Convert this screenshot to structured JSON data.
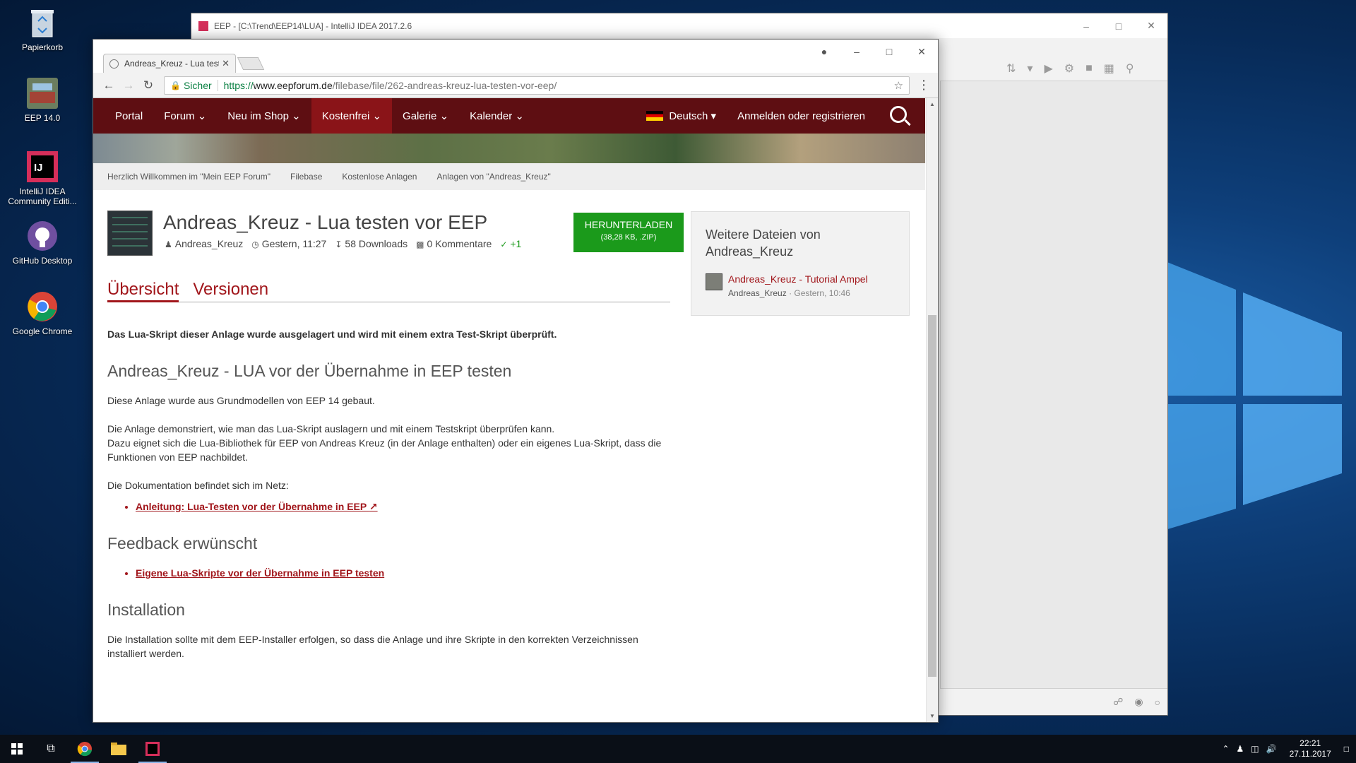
{
  "desktop": {
    "icons": [
      {
        "label": "Papierkorb",
        "icon": "recycle-bin-icon"
      },
      {
        "label": "EEP 14.0",
        "icon": "eep-icon"
      },
      {
        "label": "IntelliJ IDEA Community Editi...",
        "icon": "intellij-icon"
      },
      {
        "label": "GitHub Desktop",
        "icon": "github-icon"
      },
      {
        "label": "Google Chrome",
        "icon": "chrome-icon"
      }
    ]
  },
  "intellij": {
    "title": "EEP - [C:\\Trend\\EEP14\\LUA] - IntelliJ IDEA 2017.2.6"
  },
  "chrome": {
    "tab_title": "Andreas_Kreuz - Lua testen vor EEP",
    "secure_label": "Sicher",
    "url": {
      "scheme": "https://",
      "host": "www.eepforum.de",
      "path": "/filebase/file/262-andreas-kreuz-lua-testen-vor-eep/"
    }
  },
  "site": {
    "nav": [
      "Portal",
      "Forum",
      "Neu im Shop",
      "Kostenfrei",
      "Galerie",
      "Kalender"
    ],
    "nav_caret": [
      "",
      "⌄",
      "⌄",
      "⌄",
      "⌄",
      "⌄"
    ],
    "language": "Deutsch",
    "login": "Anmelden oder registrieren",
    "breadcrumb": [
      "Herzlich Willkommen im \"Mein EEP Forum\"",
      "Filebase",
      "Kostenlose Anlagen",
      "Anlagen von \"Andreas_Kreuz\""
    ]
  },
  "file": {
    "title": "Andreas_Kreuz - Lua testen vor EEP",
    "author": "Andreas_Kreuz",
    "date": "Gestern, 11:27",
    "downloads": "58 Downloads",
    "comments": "0 Kommentare",
    "likes": "+1",
    "download_label": "HERUNTERLADEN",
    "download_info": "(38,28 KB, .ZIP)"
  },
  "tabs": [
    "Übersicht",
    "Versionen"
  ],
  "content": {
    "intro": "Das Lua-Skript dieser Anlage wurde ausgelagert und wird mit einem extra Test-Skript überprüft.",
    "h1": "Andreas_Kreuz - LUA vor der Übernahme in EEP testen",
    "p1": "Diese Anlage wurde aus Grundmodellen von EEP 14 gebaut.",
    "p2a": "Die Anlage demonstriert, wie man das Lua-Skript auslagern und mit einem Testskript überprüfen kann.",
    "p2b": "Dazu eignet sich die Lua-Bibliothek für EEP von Andreas Kreuz (in der Anlage enthalten) oder ein eigenes Lua-Skript, dass die Funktionen von EEP nachbildet.",
    "p3": "Die Dokumentation befindet sich im Netz:",
    "link1": "Anleitung: Lua-Testen vor der Übernahme in EEP",
    "h2": "Feedback erwünscht",
    "link2": "Eigene Lua-Skripte vor der Übernahme in EEP testen",
    "h3": "Installation",
    "p4": "Die Installation sollte mit dem EEP-Installer erfolgen, so dass die Anlage und ihre Skripte in den korrekten Verzeichnissen installiert werden."
  },
  "sidebar": {
    "title": "Weitere Dateien von Andreas_Kreuz",
    "item_title": "Andreas_Kreuz - Tutorial Ampel",
    "item_author": "Andreas_Kreuz",
    "item_date": "Gestern, 10:46"
  },
  "taskbar": {
    "time": "22:21",
    "date": "27.11.2017"
  },
  "colors": {
    "nav_bg": "#5e0e12",
    "accent": "#a1161b",
    "download_green": "#1b9a1b"
  }
}
